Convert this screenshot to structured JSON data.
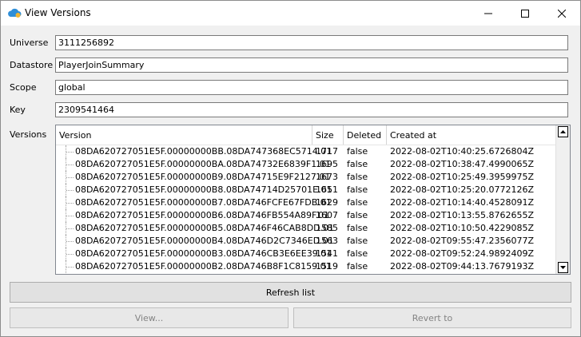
{
  "window": {
    "title": "View Versions",
    "icon": "cloud-icon"
  },
  "fields": {
    "universe": {
      "label": "Universe",
      "value": "3111256892"
    },
    "datastore": {
      "label": "Datastore",
      "value": "PlayerJoinSummary"
    },
    "scope": {
      "label": "Scope",
      "value": "global"
    },
    "key": {
      "label": "Key",
      "value": "2309541464"
    }
  },
  "versions": {
    "label": "Versions",
    "columns": [
      "Version",
      "Size",
      "Deleted",
      "Created at"
    ],
    "rows": [
      {
        "version": "08DA620727051E5F.00000000BB.08DA747368EC5714.01",
        "size": "1717",
        "deleted": "false",
        "created": "2022-08-02T10:40:25.6726804Z"
      },
      {
        "version": "08DA620727051E5F.00000000BA.08DA74732E6839F1.01",
        "size": "1695",
        "deleted": "false",
        "created": "2022-08-02T10:38:47.4990065Z"
      },
      {
        "version": "08DA620727051E5F.00000000B9.08DA74715E9F2127.01",
        "size": "1673",
        "deleted": "false",
        "created": "2022-08-02T10:25:49.3959975Z"
      },
      {
        "version": "08DA620727051E5F.00000000B8.08DA74714D25701E.01",
        "size": "1651",
        "deleted": "false",
        "created": "2022-08-02T10:25:20.0772126Z"
      },
      {
        "version": "08DA620727051E5F.00000000B7.08DA746FCFE67FDB.01",
        "size": "1629",
        "deleted": "false",
        "created": "2022-08-02T10:14:40.4528091Z"
      },
      {
        "version": "08DA620727051E5F.00000000B6.08DA746FB554A89F.01",
        "size": "1607",
        "deleted": "false",
        "created": "2022-08-02T10:13:55.8762655Z"
      },
      {
        "version": "08DA620727051E5F.00000000B5.08DA746F46CAB8DD.01",
        "size": "1585",
        "deleted": "false",
        "created": "2022-08-02T10:10:50.4229085Z"
      },
      {
        "version": "08DA620727051E5F.00000000B4.08DA746D2C7346ED.01",
        "size": "1563",
        "deleted": "false",
        "created": "2022-08-02T09:55:47.2356077Z"
      },
      {
        "version": "08DA620727051E5F.00000000B3.08DA746CB3E6EE39.01",
        "size": "1541",
        "deleted": "false",
        "created": "2022-08-02T09:52:24.9892409Z"
      },
      {
        "version": "08DA620727051E5F.00000000B2.08DA746B8F1C8159.01",
        "size": "1519",
        "deleted": "false",
        "created": "2022-08-02T09:44:13.7679193Z"
      }
    ]
  },
  "buttons": {
    "refresh": "Refresh list",
    "view": "View...",
    "revert": "Revert to"
  },
  "colors": {
    "window_bg": "#f0f0f0",
    "button_bg": "#e1e1e1",
    "disabled_text": "#838383"
  }
}
